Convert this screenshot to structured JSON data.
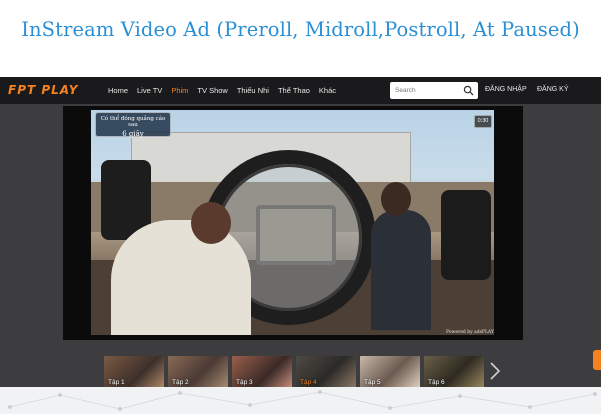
{
  "banner": {
    "title": "InStream Video Ad (Preroll, Midroll,Postroll, At Paused)"
  },
  "app": {
    "logo": "FPT PLAY",
    "nav": [
      {
        "label": "Home",
        "active": false
      },
      {
        "label": "Live TV",
        "active": false
      },
      {
        "label": "Phim",
        "active": true
      },
      {
        "label": "TV Show",
        "active": false
      },
      {
        "label": "Thiếu Nhi",
        "active": false
      },
      {
        "label": "Thể Thao",
        "active": false
      },
      {
        "label": "Khác",
        "active": false
      }
    ],
    "search": {
      "placeholder": "Search"
    },
    "login_label": "ĐĂNG NHẬP",
    "register_label": "ĐĂNG KÝ",
    "accent_color": "#f58220"
  },
  "player": {
    "skip_text": "Có thể đóng quảng cáo sau",
    "skip_countdown": "6 giây",
    "timer": "0:30",
    "powered_by": "Powered by adsPLAY"
  },
  "episodes": [
    {
      "label": "Tập 1",
      "active": false
    },
    {
      "label": "Tập 2",
      "active": false
    },
    {
      "label": "Tập 3",
      "active": false
    },
    {
      "label": "Tập 4",
      "active": true
    },
    {
      "label": "Tập 5",
      "active": false
    },
    {
      "label": "Tập 6",
      "active": false
    }
  ]
}
